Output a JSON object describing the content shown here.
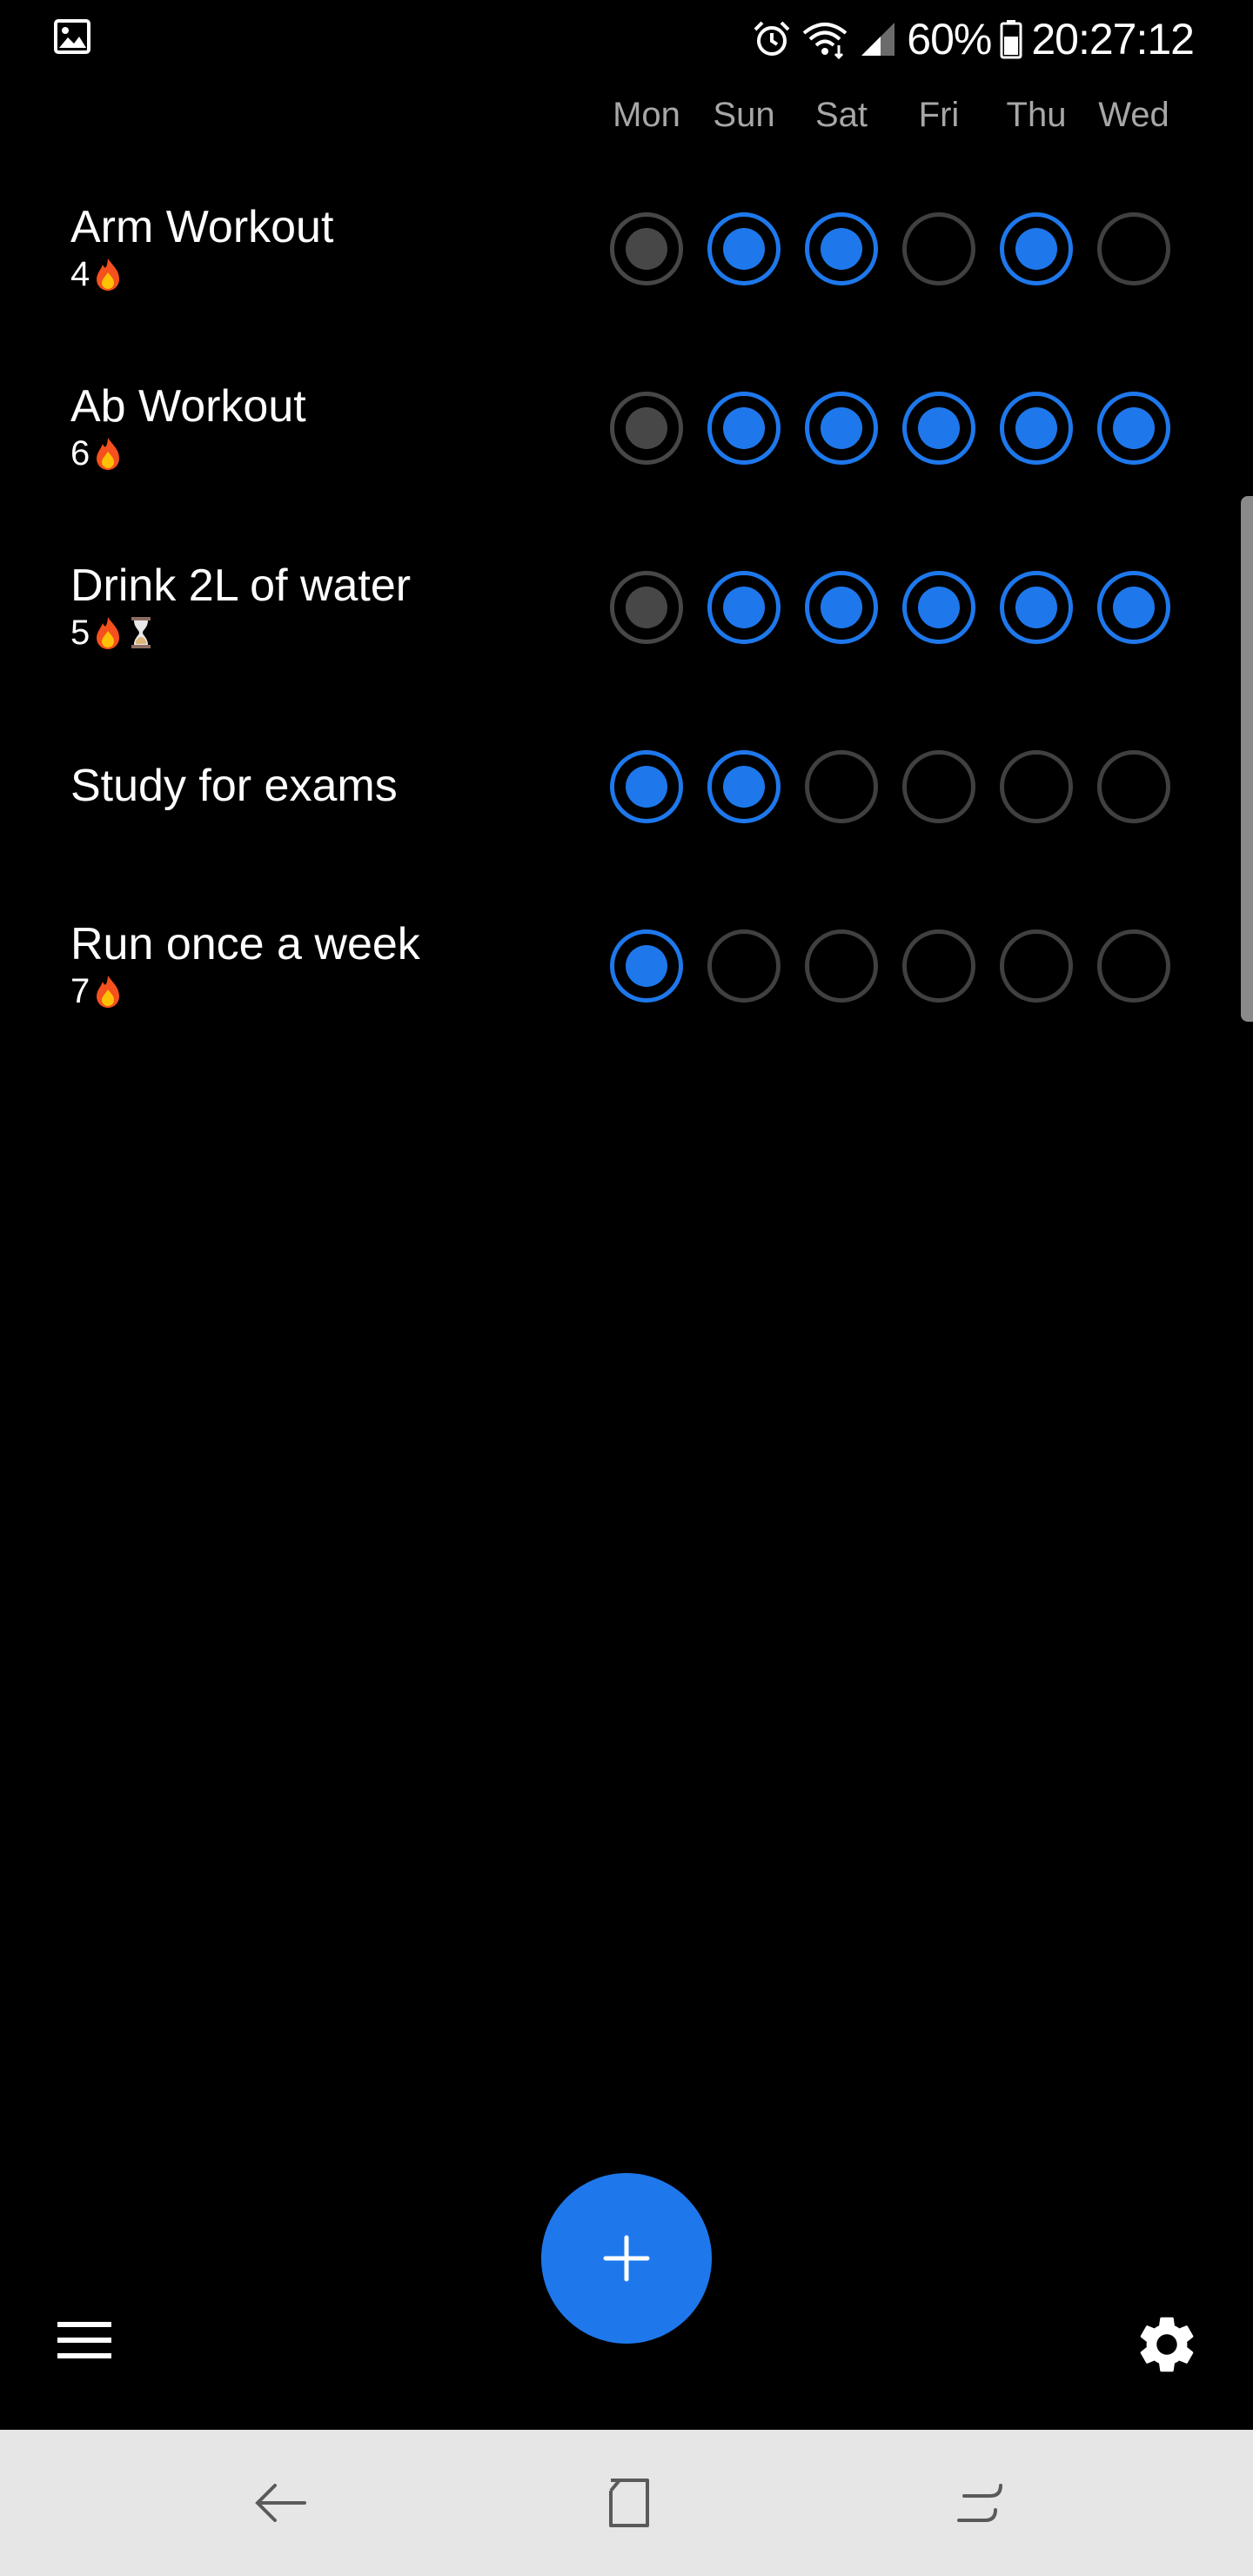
{
  "status_bar": {
    "battery": "60%",
    "time": "20:27:12",
    "icons": [
      "gallery-icon",
      "alarm-icon",
      "wifi-icon",
      "signal-icon",
      "battery-icon"
    ]
  },
  "days": [
    "Mon",
    "Sun",
    "Sat",
    "Fri",
    "Thu",
    "Wed"
  ],
  "habits": [
    {
      "name": "Arm Workout",
      "streak": "4",
      "streak_icon": "fire-icon",
      "extra_icon": "",
      "checks": [
        "skipped",
        "done",
        "done",
        "empty",
        "done",
        "empty"
      ]
    },
    {
      "name": "Ab Workout",
      "streak": "6",
      "streak_icon": "fire-icon",
      "extra_icon": "",
      "checks": [
        "skipped",
        "done",
        "done",
        "done",
        "done",
        "done"
      ]
    },
    {
      "name": "Drink 2L of water",
      "streak": "5",
      "streak_icon": "fire-icon",
      "extra_icon": "hourglass-icon",
      "checks": [
        "skipped",
        "done",
        "done",
        "done",
        "done",
        "done"
      ]
    },
    {
      "name": "Study for exams",
      "streak": "",
      "streak_icon": "",
      "extra_icon": "",
      "checks": [
        "done",
        "done",
        "empty",
        "empty",
        "empty",
        "empty"
      ]
    },
    {
      "name": "Run once a week",
      "streak": "7",
      "streak_icon": "fire-icon",
      "extra_icon": "",
      "checks": [
        "done",
        "empty",
        "empty",
        "empty",
        "empty",
        "empty"
      ]
    }
  ],
  "controls": {
    "add_icon": "plus-icon",
    "menu_icon": "hamburger-menu-icon",
    "settings_icon": "gear-icon"
  },
  "nav_bar": {
    "icons": [
      "back-icon",
      "home-icon",
      "recents-icon"
    ]
  },
  "colors": {
    "accent": "#1e78ec",
    "ring_empty": "#404040",
    "ring_skipped": "#474747",
    "day_label": "#a7a7a7",
    "background": "#000000",
    "nav_background": "#e6e6e6"
  }
}
